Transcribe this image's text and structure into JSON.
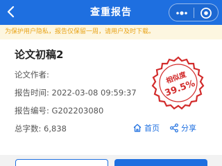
{
  "nav": {
    "title": "查重报告"
  },
  "notice": {
    "text": "为保护用户隐私，报告仅保留一周，请用户及时下载。"
  },
  "report": {
    "title": "论文初稿2",
    "author": "论文作者:",
    "time": "报告时间: 2022-03-08 09:59:37",
    "number": "报告编号: G202203080",
    "words": "总字数: 6,838"
  },
  "stamp": {
    "label": "相似度",
    "value": "39.5%"
  },
  "actions": {
    "home": "首页",
    "share": "分享"
  },
  "colors": {
    "primary": "#1e6fe0",
    "stamp": "#d22b2b",
    "notice_bg": "#fdf6e0",
    "notice_text": "#e8a317"
  }
}
